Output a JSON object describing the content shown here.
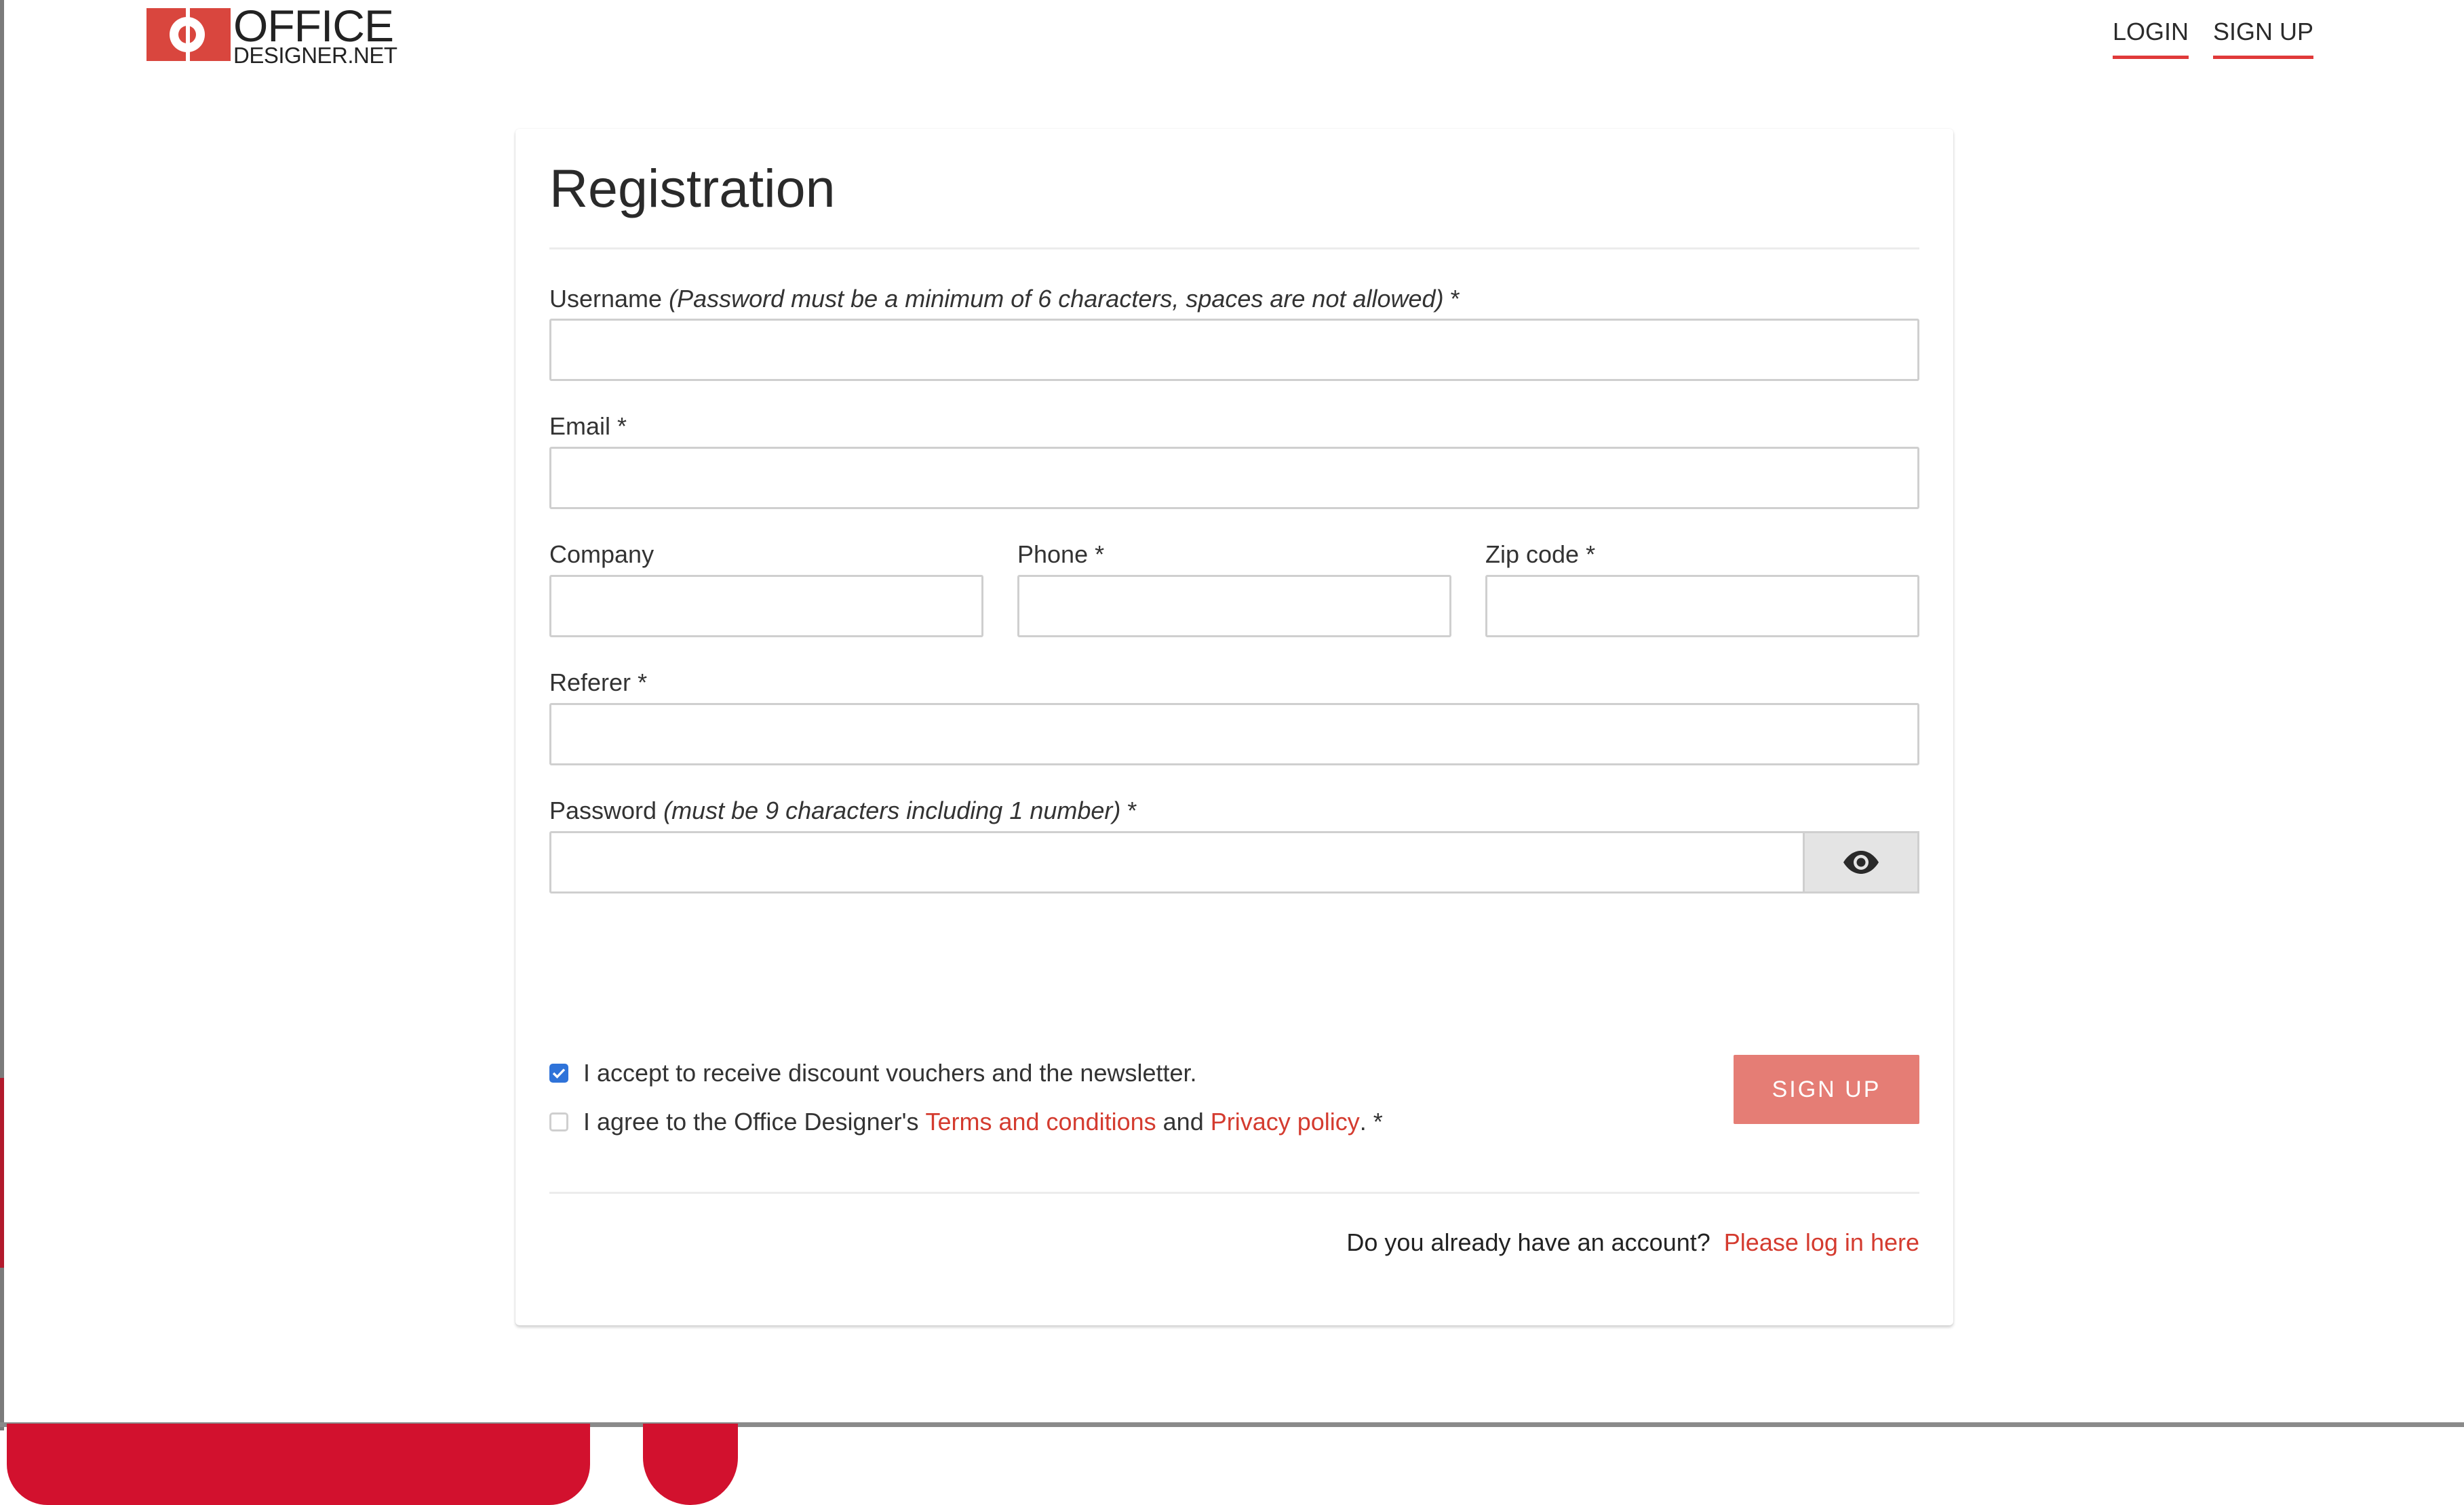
{
  "header": {
    "logo": {
      "line1": "OFFICE",
      "line2": "DESIGNER.NET"
    },
    "nav": {
      "login": "LOGIN",
      "signup": "SIGN UP"
    }
  },
  "form": {
    "title": "Registration",
    "username": {
      "label": "Username",
      "hint": "(Password must be a minimum of 6 characters, spaces are not allowed)",
      "required": "*",
      "value": ""
    },
    "email": {
      "label": "Email",
      "required": "*",
      "value": ""
    },
    "company": {
      "label": "Company",
      "value": ""
    },
    "phone": {
      "label": "Phone",
      "required": "*",
      "value": ""
    },
    "zip": {
      "label": "Zip code",
      "required": "*",
      "value": ""
    },
    "referer": {
      "label": "Referer",
      "required": "*",
      "value": ""
    },
    "password": {
      "label": "Password",
      "hint": "(must be 9 characters including 1 number)",
      "required": "*",
      "value": ""
    },
    "newsletter": {
      "checked": true,
      "label": "I accept to receive discount vouchers and the newsletter."
    },
    "terms": {
      "checked": false,
      "pre": "I agree to the Office Designer's ",
      "terms_link": "Terms and conditions",
      "mid": " and ",
      "privacy_link": "Privacy policy",
      "post": ". *"
    },
    "submit_label": "SIGN UP",
    "footer": {
      "question": "Do you already have an account? ",
      "link": "Please log in here"
    }
  },
  "colors": {
    "accent_red": "#d43b2f",
    "button_bg": "#e57d75",
    "checkbox_blue": "#2f73d9",
    "logo_red": "#d9463e"
  },
  "icons": {
    "password_toggle": "eye-icon",
    "checkbox_checked": "checkmark-icon"
  }
}
